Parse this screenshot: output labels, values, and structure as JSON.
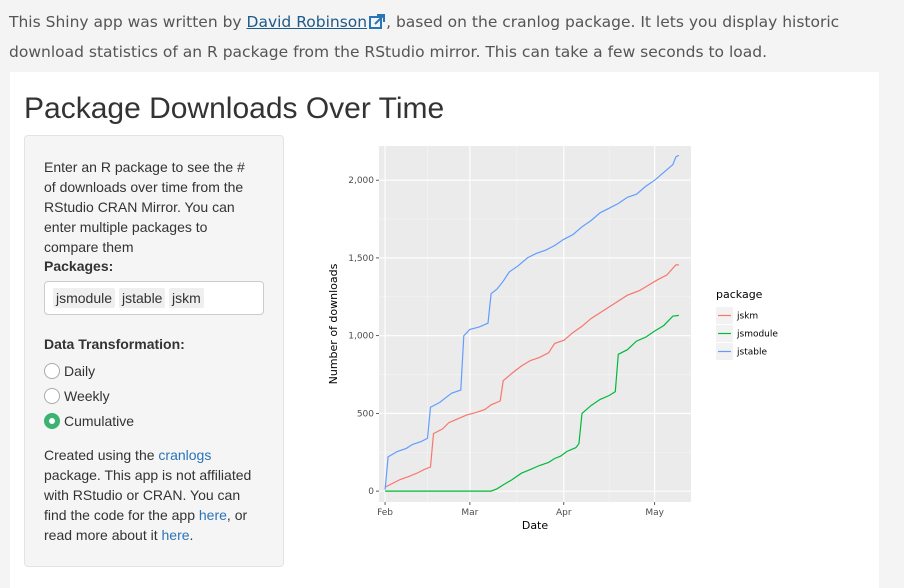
{
  "intro": {
    "text_before": "This Shiny app was written by ",
    "author_link": "David Robinson",
    "text_after": ", based on the cranlog package. It lets you display historic download statistics of an R package from the RStudio mirror. This can take a few seconds to load."
  },
  "page_title": "Package Downloads Over Time",
  "sidebar": {
    "description": "Enter an R package to see the # of downloads over time from the RStudio CRAN Mirror. You can enter multiple packages to compare them",
    "packages_label": "Packages:",
    "packages": [
      "jsmodule",
      "jstable",
      "jskm"
    ],
    "transform_label": "Data Transformation:",
    "transform_options": [
      "Daily",
      "Weekly",
      "Cumulative"
    ],
    "transform_selected": "Cumulative",
    "footer": {
      "t1": "Created using the ",
      "link1": "cranlogs",
      "t2": " package. This app is not affiliated with RStudio or CRAN. You can find the code for the app ",
      "link2": "here",
      "t3": ", or read more about it ",
      "link3": "here",
      "t4": "."
    }
  },
  "chart_data": {
    "type": "line",
    "xlabel": "Date",
    "ylabel": "Number of downloads",
    "x_ticks": [
      "Feb",
      "Mar",
      "Apr",
      "May"
    ],
    "x_tick_dates": [
      "2018-02-01",
      "2018-03-01",
      "2018-04-01",
      "2018-05-01"
    ],
    "xlim": [
      "2018-01-30",
      "2018-05-13"
    ],
    "ylim": [
      -70,
      2220
    ],
    "y_ticks": [
      0,
      500,
      1000,
      1500,
      2000
    ],
    "y_tick_labels": [
      "0",
      "500",
      "1,000",
      "1,500",
      "2,000"
    ],
    "grid": true,
    "legend_title": "package",
    "legend_position": "right",
    "series": [
      {
        "name": "jskm",
        "color": "#F8766D",
        "points": [
          [
            "2018-02-01",
            25
          ],
          [
            "2018-02-03",
            45
          ],
          [
            "2018-02-06",
            75
          ],
          [
            "2018-02-09",
            95
          ],
          [
            "2018-02-12",
            120
          ],
          [
            "2018-02-14",
            140
          ],
          [
            "2018-02-16",
            155
          ],
          [
            "2018-02-17",
            370
          ],
          [
            "2018-02-20",
            400
          ],
          [
            "2018-02-22",
            440
          ],
          [
            "2018-02-25",
            465
          ],
          [
            "2018-02-28",
            490
          ],
          [
            "2018-03-03",
            505
          ],
          [
            "2018-03-06",
            525
          ],
          [
            "2018-03-08",
            555
          ],
          [
            "2018-03-11",
            580
          ],
          [
            "2018-03-12",
            710
          ],
          [
            "2018-03-15",
            760
          ],
          [
            "2018-03-18",
            805
          ],
          [
            "2018-03-21",
            840
          ],
          [
            "2018-03-24",
            860
          ],
          [
            "2018-03-27",
            890
          ],
          [
            "2018-03-29",
            950
          ],
          [
            "2018-04-01",
            970
          ],
          [
            "2018-04-04",
            1020
          ],
          [
            "2018-04-07",
            1060
          ],
          [
            "2018-04-10",
            1110
          ],
          [
            "2018-04-14",
            1160
          ],
          [
            "2018-04-18",
            1210
          ],
          [
            "2018-04-22",
            1260
          ],
          [
            "2018-04-26",
            1290
          ],
          [
            "2018-04-29",
            1325
          ],
          [
            "2018-05-02",
            1360
          ],
          [
            "2018-05-05",
            1390
          ],
          [
            "2018-05-08",
            1455
          ],
          [
            "2018-05-09",
            1455
          ]
        ]
      },
      {
        "name": "jsmodule",
        "color": "#00BA38",
        "points": [
          [
            "2018-02-01",
            0
          ],
          [
            "2018-03-08",
            0
          ],
          [
            "2018-03-10",
            15
          ],
          [
            "2018-03-12",
            40
          ],
          [
            "2018-03-15",
            75
          ],
          [
            "2018-03-18",
            115
          ],
          [
            "2018-03-21",
            140
          ],
          [
            "2018-03-24",
            165
          ],
          [
            "2018-03-27",
            185
          ],
          [
            "2018-03-29",
            210
          ],
          [
            "2018-03-31",
            225
          ],
          [
            "2018-04-02",
            255
          ],
          [
            "2018-04-05",
            280
          ],
          [
            "2018-04-06",
            305
          ],
          [
            "2018-04-07",
            500
          ],
          [
            "2018-04-10",
            550
          ],
          [
            "2018-04-13",
            590
          ],
          [
            "2018-04-16",
            615
          ],
          [
            "2018-04-18",
            640
          ],
          [
            "2018-04-19",
            880
          ],
          [
            "2018-04-22",
            910
          ],
          [
            "2018-04-25",
            965
          ],
          [
            "2018-04-28",
            990
          ],
          [
            "2018-05-01",
            1030
          ],
          [
            "2018-05-04",
            1065
          ],
          [
            "2018-05-07",
            1125
          ],
          [
            "2018-05-09",
            1130
          ]
        ]
      },
      {
        "name": "jstable",
        "color": "#619CFF",
        "points": [
          [
            "2018-02-01",
            10
          ],
          [
            "2018-02-02",
            220
          ],
          [
            "2018-02-05",
            255
          ],
          [
            "2018-02-08",
            275
          ],
          [
            "2018-02-10",
            300
          ],
          [
            "2018-02-13",
            320
          ],
          [
            "2018-02-15",
            340
          ],
          [
            "2018-02-16",
            540
          ],
          [
            "2018-02-19",
            570
          ],
          [
            "2018-02-21",
            600
          ],
          [
            "2018-02-23",
            630
          ],
          [
            "2018-02-26",
            650
          ],
          [
            "2018-02-27",
            1000
          ],
          [
            "2018-03-01",
            1040
          ],
          [
            "2018-03-04",
            1055
          ],
          [
            "2018-03-07",
            1080
          ],
          [
            "2018-03-08",
            1270
          ],
          [
            "2018-03-10",
            1300
          ],
          [
            "2018-03-12",
            1350
          ],
          [
            "2018-03-14",
            1410
          ],
          [
            "2018-03-17",
            1450
          ],
          [
            "2018-03-20",
            1500
          ],
          [
            "2018-03-23",
            1530
          ],
          [
            "2018-03-26",
            1550
          ],
          [
            "2018-03-29",
            1580
          ],
          [
            "2018-04-01",
            1620
          ],
          [
            "2018-04-04",
            1650
          ],
          [
            "2018-04-07",
            1700
          ],
          [
            "2018-04-10",
            1740
          ],
          [
            "2018-04-13",
            1790
          ],
          [
            "2018-04-16",
            1820
          ],
          [
            "2018-04-19",
            1850
          ],
          [
            "2018-04-22",
            1890
          ],
          [
            "2018-04-25",
            1910
          ],
          [
            "2018-04-28",
            1960
          ],
          [
            "2018-05-01",
            2000
          ],
          [
            "2018-05-04",
            2050
          ],
          [
            "2018-05-07",
            2100
          ],
          [
            "2018-05-08",
            2150
          ],
          [
            "2018-05-09",
            2160
          ]
        ]
      }
    ]
  }
}
